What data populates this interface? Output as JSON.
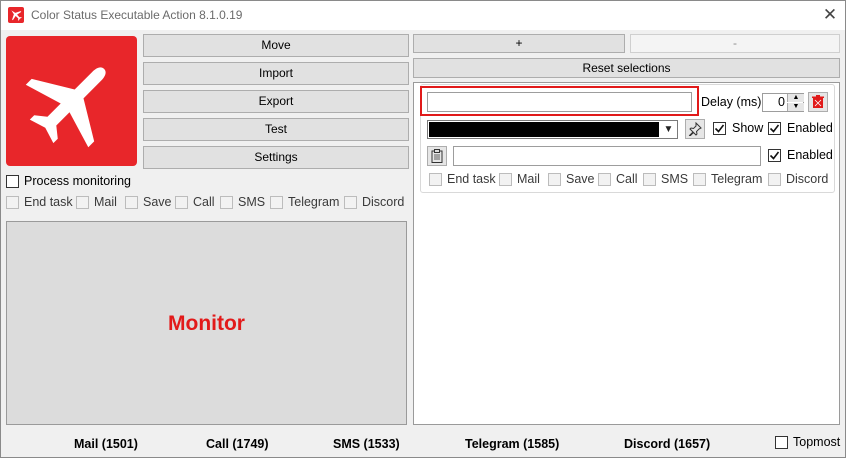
{
  "window": {
    "title": "Color Status Executable Action 8.1.0.19"
  },
  "buttons": {
    "move": "Move",
    "import": "Import",
    "export": "Export",
    "test": "Test",
    "settings": "Settings",
    "plus": "+",
    "minus": "-",
    "reset": "Reset selections"
  },
  "left": {
    "process_monitoring": "Process monitoring",
    "actions": [
      "End task",
      "Mail",
      "Save",
      "Call",
      "SMS",
      "Telegram",
      "Discord"
    ],
    "monitor_label": "Monitor"
  },
  "entry": {
    "name_value": "",
    "delay_label": "Delay (ms)",
    "delay_value": "0",
    "color_value": "#000000",
    "show_label": "Show",
    "enabled_label": "Enabled",
    "path_value": "",
    "enabled2_label": "Enabled",
    "actions": [
      "End task",
      "Mail",
      "Save",
      "Call",
      "SMS",
      "Telegram",
      "Discord"
    ]
  },
  "footer": {
    "mail": "Mail (1501)",
    "call": "Call (1749)",
    "sms": "SMS (1533)",
    "telegram": "Telegram (1585)",
    "discord": "Discord (1657)",
    "topmost": "Topmost"
  },
  "icons": {
    "app": "airplane-icon",
    "pin": "pin-icon",
    "trash": "trash-icon",
    "clipboard": "clipboard-icon",
    "close": "close-icon"
  },
  "colors": {
    "brand_red": "#e8262a",
    "highlight_red": "#e11a1a",
    "monitor_text": "#e21a1a"
  }
}
